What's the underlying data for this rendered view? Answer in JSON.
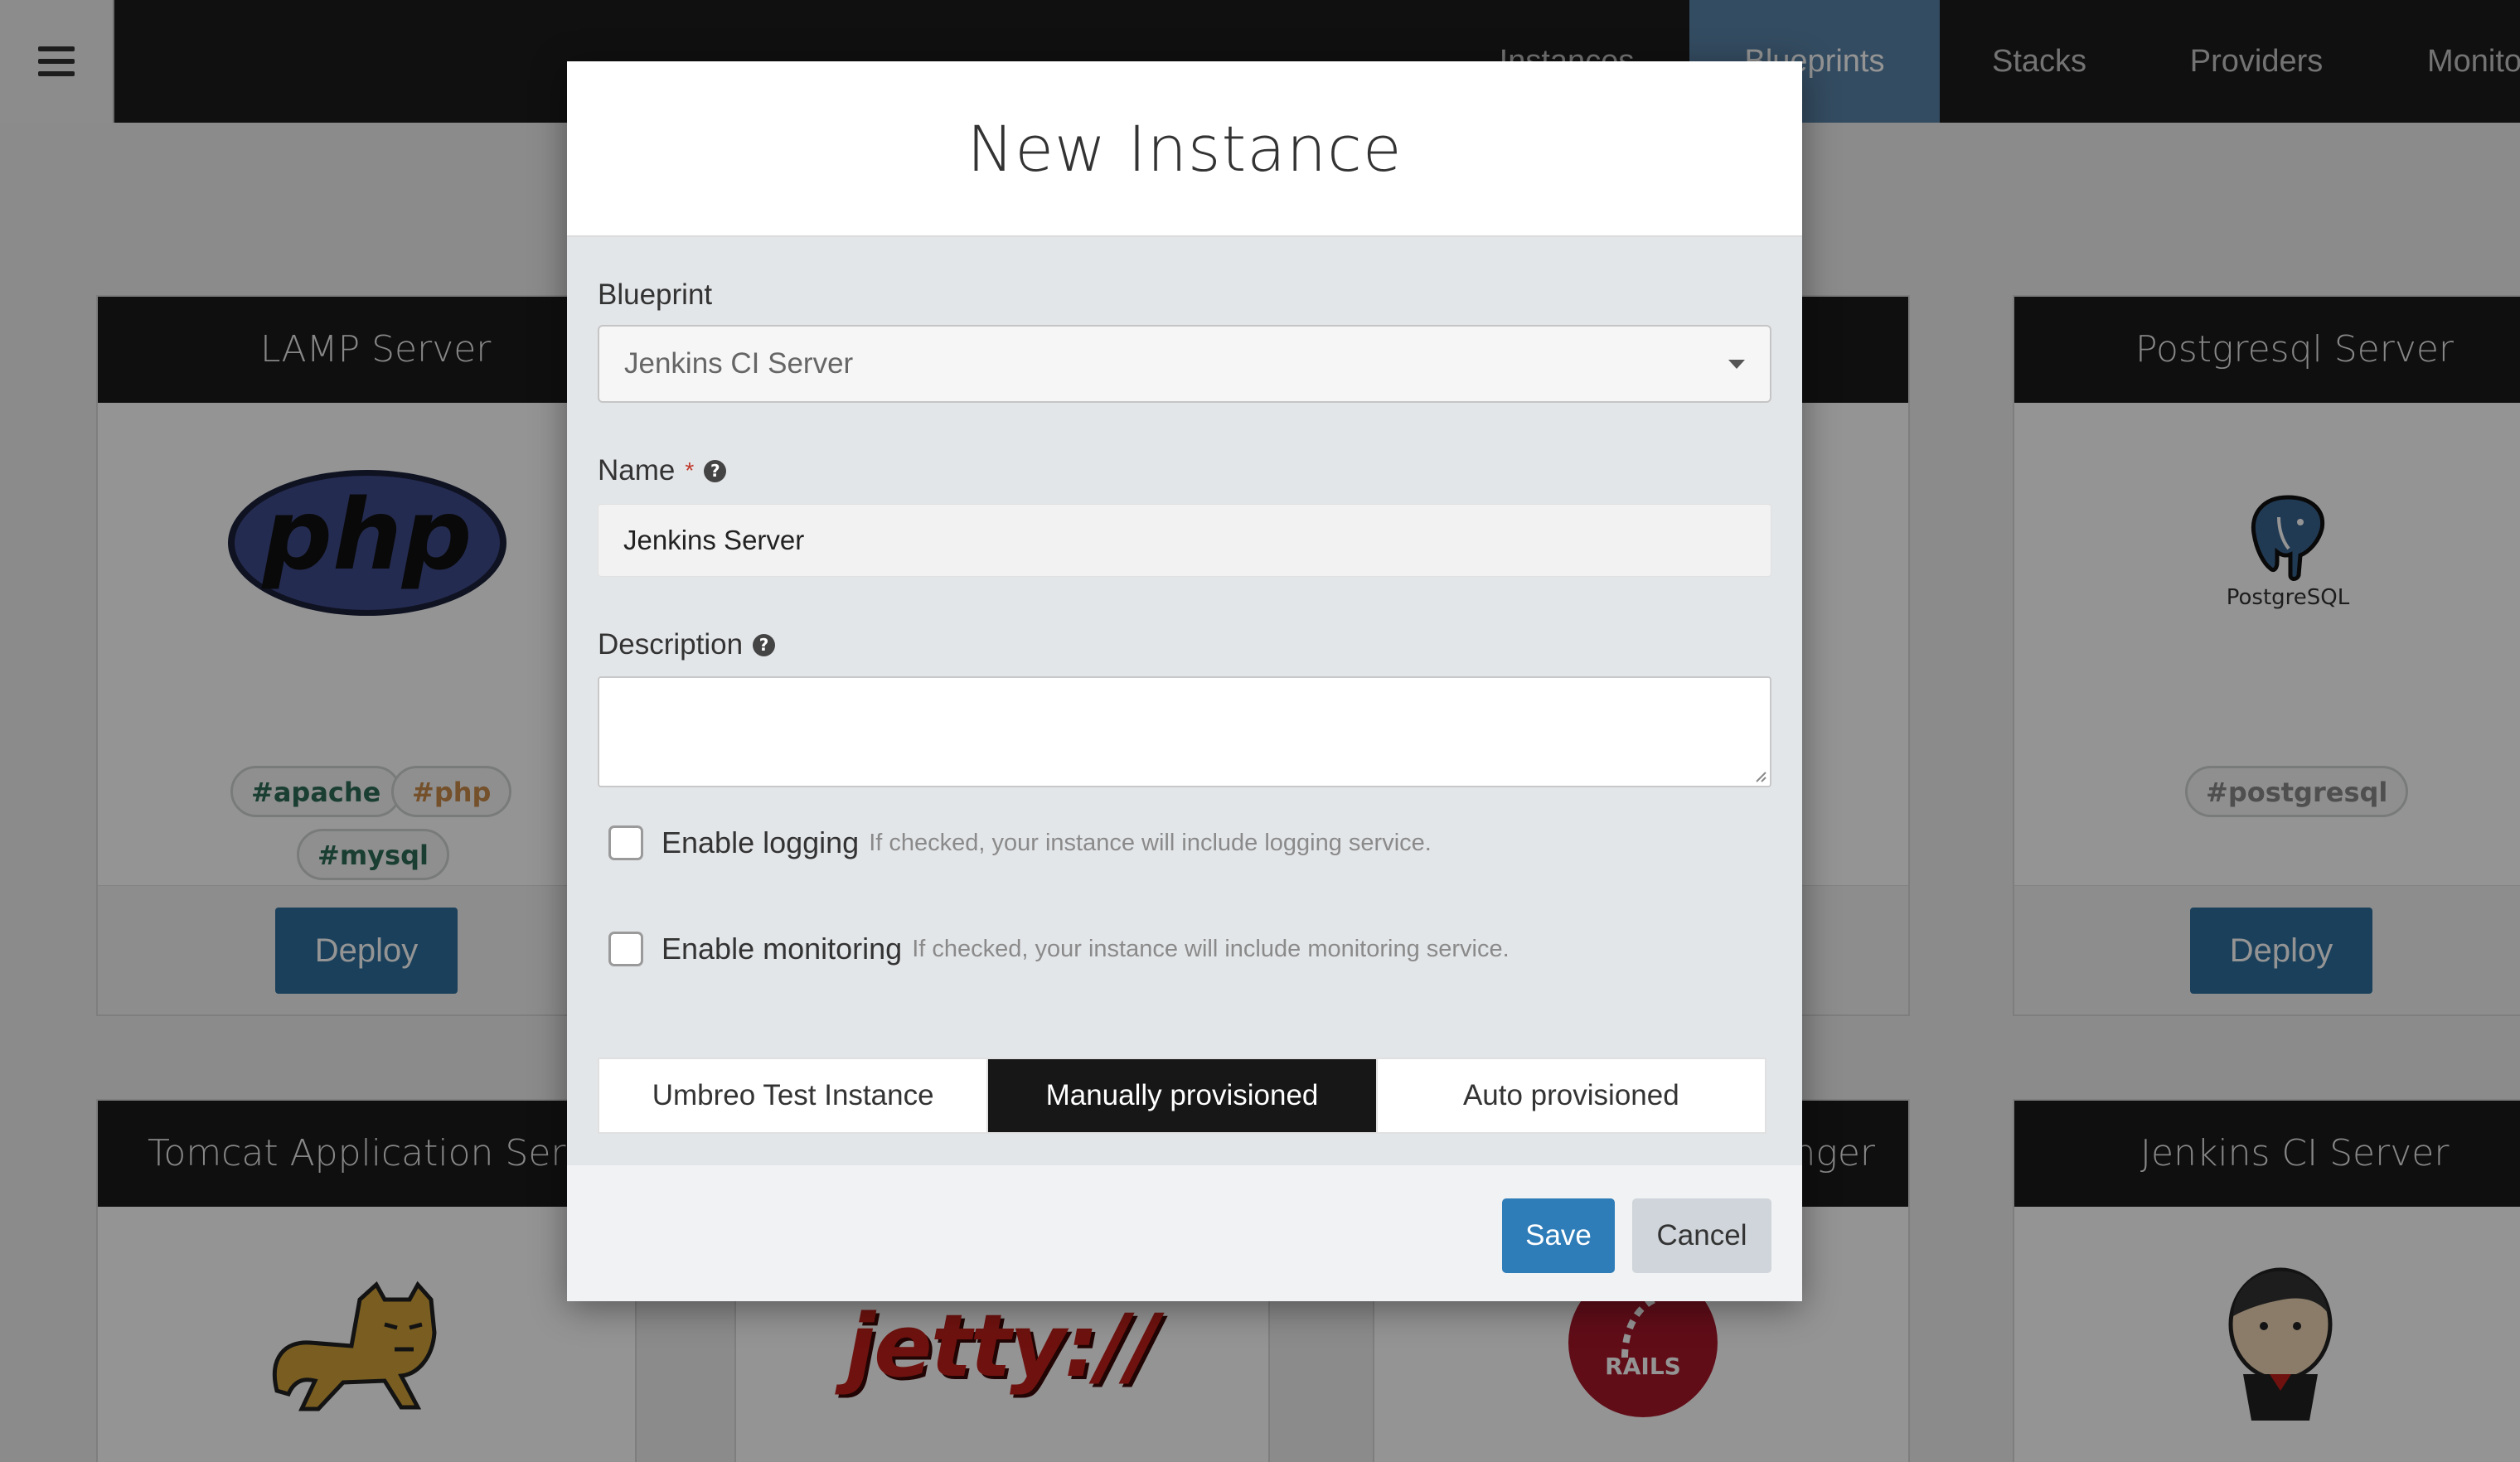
{
  "nav": {
    "items": [
      "Instances",
      "Blueprints",
      "Stacks",
      "Providers",
      "Monito"
    ],
    "active": "Blueprints"
  },
  "cards": {
    "lamp": {
      "title": "LAMP Server",
      "logo_text": "php",
      "tags": [
        "#apache",
        "#php",
        "#mysql"
      ],
      "deploy": "Deploy"
    },
    "postgres": {
      "title": "Postgresql Server",
      "logo_text": "PostgreSQL",
      "tags": [
        "#postgresql"
      ],
      "deploy": "Deploy"
    },
    "mid_partial": {
      "title": "nger"
    },
    "tomcat": {
      "title": "Tomcat Application Server"
    },
    "jetty": {
      "logo_text": "jetty://"
    },
    "rails": {
      "logo_text": "RAILS"
    },
    "jenkins": {
      "title": "Jenkins CI Server"
    }
  },
  "modal": {
    "title": "New Instance",
    "blueprint": {
      "label": "Blueprint",
      "value": "Jenkins CI Server"
    },
    "name": {
      "label": "Name",
      "required_mark": "*",
      "value": "Jenkins Server"
    },
    "description": {
      "label": "Description",
      "value": ""
    },
    "logging": {
      "label": "Enable logging",
      "hint": "If checked, your instance will include logging service."
    },
    "monitoring": {
      "label": "Enable monitoring",
      "hint": "If checked, your instance will include monitoring service."
    },
    "provision_options": [
      "Umbreo Test Instance",
      "Manually provisioned",
      "Auto provisioned"
    ],
    "provision_selected": "Manually provisioned",
    "save": "Save",
    "cancel": "Cancel"
  },
  "colors": {
    "accent": "#2e7cb8",
    "nav_active": "#5b84a8",
    "tag_apache": "#2e6b57",
    "tag_php": "#c98a4a",
    "tag_mysql": "#2e6b57",
    "tag_postgresql": "#888888"
  }
}
